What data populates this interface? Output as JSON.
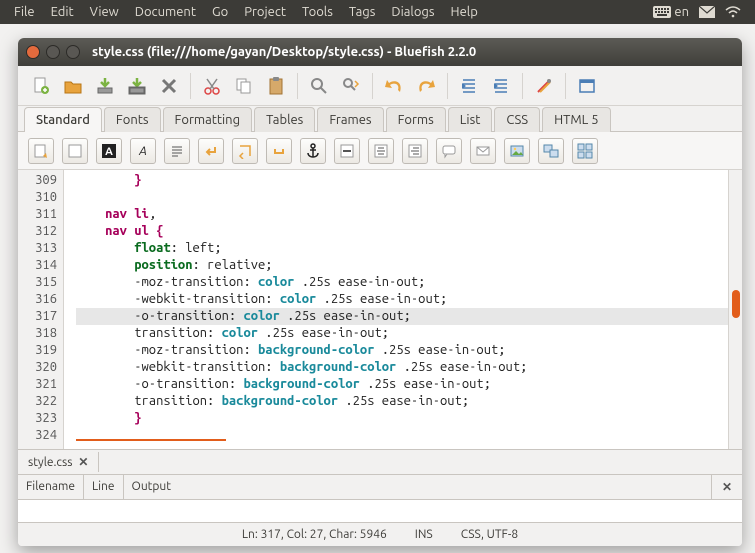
{
  "menubar": {
    "items": [
      "File",
      "Edit",
      "View",
      "Document",
      "Go",
      "Project",
      "Tools",
      "Tags",
      "Dialogs",
      "Help"
    ],
    "tray": {
      "lang": "en"
    }
  },
  "window": {
    "title": "style.css (file:///home/gayan/Desktop/style.css) - Bluefish 2.2.0"
  },
  "categoryTabs": [
    "Standard",
    "Fonts",
    "Formatting",
    "Tables",
    "Frames",
    "Forms",
    "List",
    "CSS",
    "HTML 5"
  ],
  "activeCategoryTab": 0,
  "editor": {
    "firstLine": 309,
    "highlightedLine": 317,
    "lines": [
      {
        "n": 309,
        "indent": 8,
        "segs": [
          {
            "t": "}",
            "c": "brace"
          }
        ]
      },
      {
        "n": 310,
        "indent": 0,
        "segs": []
      },
      {
        "n": 311,
        "indent": 4,
        "segs": [
          {
            "t": "nav li",
            "c": "sel"
          },
          {
            "t": ",",
            "c": "txt"
          }
        ]
      },
      {
        "n": 312,
        "indent": 4,
        "segs": [
          {
            "t": "nav ul ",
            "c": "sel"
          },
          {
            "t": "{",
            "c": "brace"
          }
        ]
      },
      {
        "n": 313,
        "indent": 8,
        "segs": [
          {
            "t": "float",
            "c": "prop"
          },
          {
            "t": ": left;",
            "c": "txt"
          }
        ]
      },
      {
        "n": 314,
        "indent": 8,
        "segs": [
          {
            "t": "position",
            "c": "prop"
          },
          {
            "t": ": relative;",
            "c": "txt"
          }
        ]
      },
      {
        "n": 315,
        "indent": 8,
        "segs": [
          {
            "t": "-moz-transition: ",
            "c": "txt"
          },
          {
            "t": "color",
            "c": "kw"
          },
          {
            "t": " .25s ease-in-out;",
            "c": "txt"
          }
        ]
      },
      {
        "n": 316,
        "indent": 8,
        "segs": [
          {
            "t": "-webkit-transition: ",
            "c": "txt"
          },
          {
            "t": "color",
            "c": "kw"
          },
          {
            "t": " .25s ease-in-out;",
            "c": "txt"
          }
        ]
      },
      {
        "n": 317,
        "indent": 8,
        "segs": [
          {
            "t": "-o-transition: ",
            "c": "txt"
          },
          {
            "t": "color",
            "c": "kw"
          },
          {
            "t": " .25s ease-in-out;",
            "c": "txt"
          }
        ]
      },
      {
        "n": 318,
        "indent": 8,
        "segs": [
          {
            "t": "transition: ",
            "c": "txt"
          },
          {
            "t": "color",
            "c": "kw"
          },
          {
            "t": " .25s ease-in-out;",
            "c": "txt"
          }
        ]
      },
      {
        "n": 319,
        "indent": 8,
        "segs": [
          {
            "t": "-moz-transition: ",
            "c": "txt"
          },
          {
            "t": "background-color",
            "c": "kw"
          },
          {
            "t": " .25s ease-in-out;",
            "c": "txt"
          }
        ]
      },
      {
        "n": 320,
        "indent": 8,
        "segs": [
          {
            "t": "-webkit-transition: ",
            "c": "txt"
          },
          {
            "t": "background-color",
            "c": "kw"
          },
          {
            "t": " .25s ease-in-out;",
            "c": "txt"
          }
        ]
      },
      {
        "n": 321,
        "indent": 8,
        "segs": [
          {
            "t": "-o-transition: ",
            "c": "txt"
          },
          {
            "t": "background-color",
            "c": "kw"
          },
          {
            "t": " .25s ease-in-out;",
            "c": "txt"
          }
        ]
      },
      {
        "n": 322,
        "indent": 8,
        "segs": [
          {
            "t": "transition: ",
            "c": "txt"
          },
          {
            "t": "background-color",
            "c": "kw"
          },
          {
            "t": " .25s ease-in-out;",
            "c": "txt"
          }
        ]
      },
      {
        "n": 323,
        "indent": 8,
        "segs": [
          {
            "t": "}",
            "c": "brace"
          }
        ]
      },
      {
        "n": 324,
        "indent": 0,
        "segs": [],
        "underline": true
      }
    ]
  },
  "fileTabs": [
    {
      "label": "style.css"
    }
  ],
  "outputPanel": {
    "cols": [
      "Filename",
      "Line",
      "Output"
    ]
  },
  "status": {
    "pos": "Ln: 317, Col: 27, Char: 5946",
    "ins": "INS",
    "mode": "CSS, UTF-8"
  }
}
